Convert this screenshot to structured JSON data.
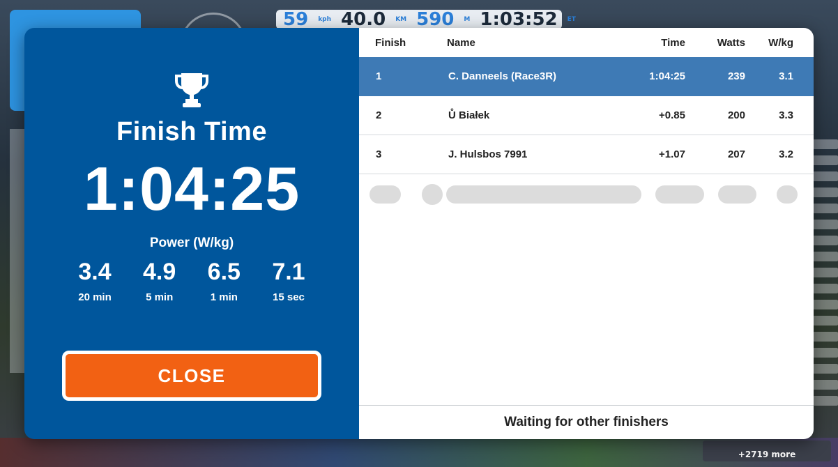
{
  "hud": {
    "speed_value": "59",
    "speed_unit": "kph",
    "distance_value": "40.0",
    "distance_unit": "KM",
    "elevation_value": "590",
    "elevation_unit": "M",
    "elapsed_time": "1:03:52",
    "elapsed_unit": "ET",
    "more_riders": "+2719 more"
  },
  "finish": {
    "title": "Finish Time",
    "time": "1:04:25",
    "power_label": "Power (W/kg)",
    "stats": [
      {
        "value": "3.4",
        "duration": "20 min"
      },
      {
        "value": "4.9",
        "duration": "5 min"
      },
      {
        "value": "6.5",
        "duration": "1 min"
      },
      {
        "value": "7.1",
        "duration": "15 sec"
      }
    ],
    "close_label": "CLOSE"
  },
  "results": {
    "headers": {
      "finish": "Finish",
      "name": "Name",
      "time": "Time",
      "watts": "Watts",
      "wkg": "W/kg"
    },
    "rows": [
      {
        "finish": "1",
        "name": "C. Danneels (Race3R)",
        "time": "1:04:25",
        "watts": "239",
        "wkg": "3.1"
      },
      {
        "finish": "2",
        "name": "Ů Białek",
        "time": "+0.85",
        "watts": "200",
        "wkg": "3.3"
      },
      {
        "finish": "3",
        "name": "J. Hulsbos 7991",
        "time": "+1.07",
        "watts": "207",
        "wkg": "3.2"
      }
    ],
    "footer": "Waiting for other finishers"
  },
  "colors": {
    "panel_blue": "#00569c",
    "highlight_row": "#3e7ab5",
    "close_button": "#f26113"
  },
  "icons": {
    "trophy": "trophy-icon"
  }
}
